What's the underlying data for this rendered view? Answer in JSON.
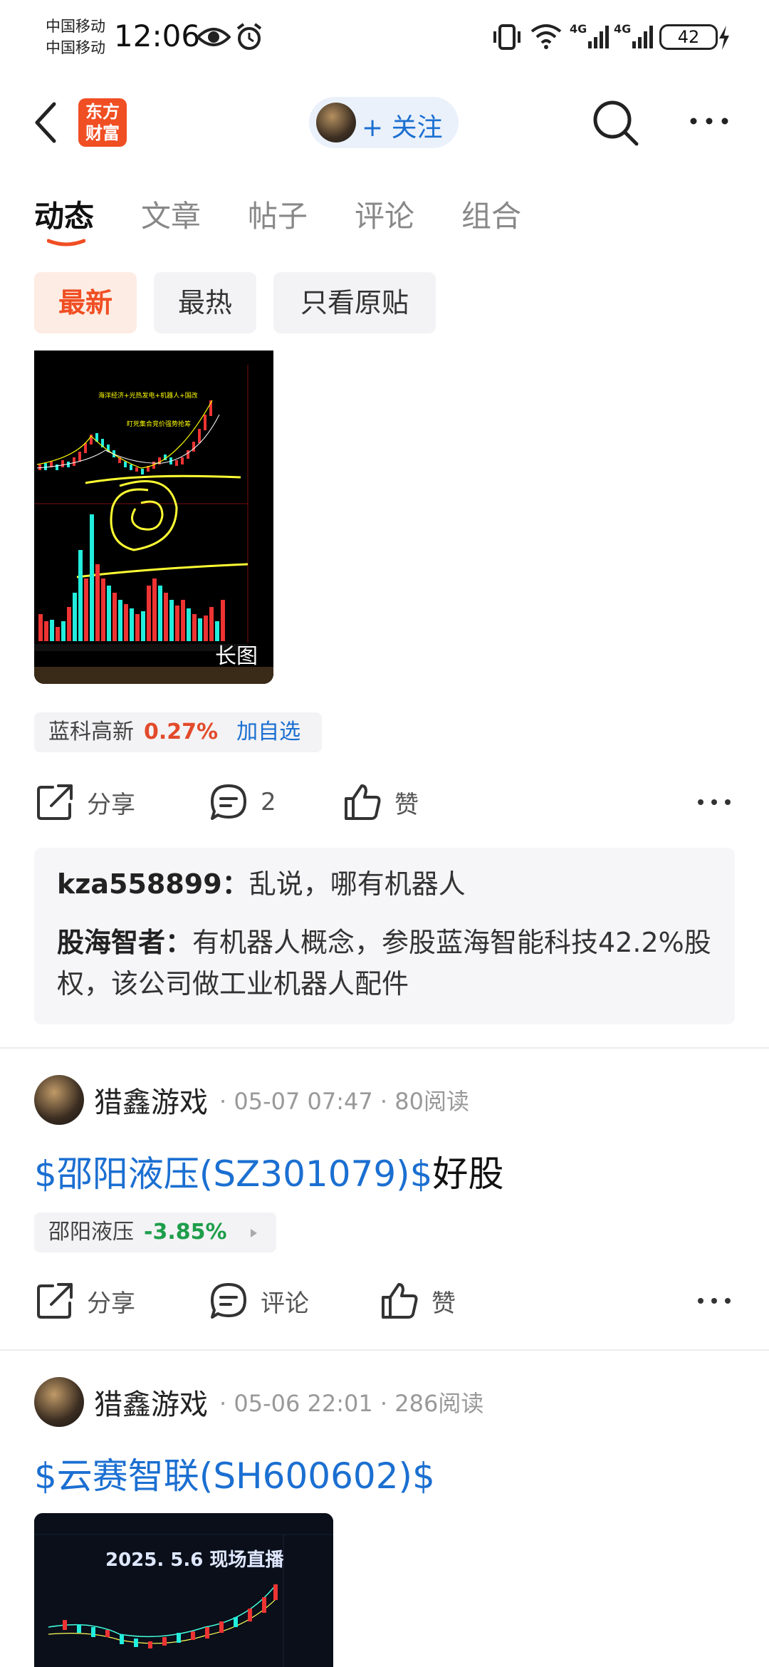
{
  "status": {
    "carrier1": "中国移动",
    "carrier2": "中国移动",
    "time": "12:06",
    "battery": "42"
  },
  "header": {
    "logo_line1": "东方",
    "logo_line2": "财富",
    "follow_label": "+ 关注"
  },
  "tabs": [
    "动态",
    "文章",
    "帖子",
    "评论",
    "组合"
  ],
  "filters": [
    "最新",
    "最热",
    "只看原贴"
  ],
  "post1": {
    "image_badge": "长图",
    "stock_name": "蓝科高新",
    "stock_change": "0.27%",
    "add_watch": "加自选",
    "share": "分享",
    "comments": "2",
    "like": "赞",
    "comment_list": [
      {
        "user": "kza558899",
        "text": "乱说，哪有机器人"
      },
      {
        "user": "股海智者",
        "text": "有机器人概念，参股蓝海智能科技42.2%股权，该公司做工业机器人配件"
      }
    ]
  },
  "post2": {
    "author": "猎鑫游戏",
    "meta": "· 05-07 07:47 · 80阅读",
    "title_link": "$邵阳液压(SZ301079)$",
    "title_rest": "好股",
    "stock_name": "邵阳液压",
    "stock_change": "-3.85%",
    "share": "分享",
    "comment": "评论",
    "like": "赞"
  },
  "post3": {
    "author": "猎鑫游戏",
    "meta": "· 05-06 22:01 · 286阅读",
    "title_link": "$云赛智联(SH600602)$"
  },
  "colors": {
    "brand": "#f04e23",
    "link": "#1b6fd1",
    "up": "#e24a2b",
    "down": "#1e9e4a"
  }
}
